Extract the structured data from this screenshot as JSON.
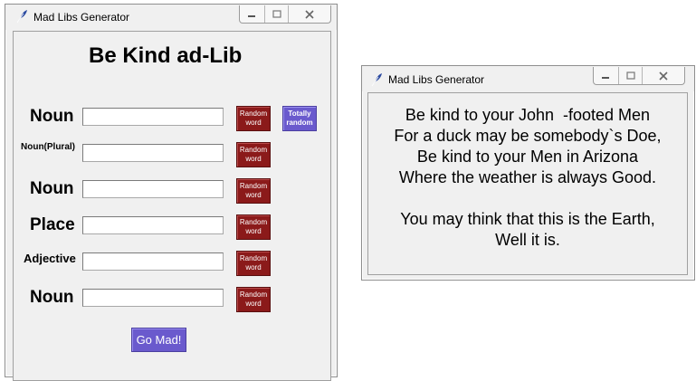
{
  "generator_window": {
    "title": "Mad Libs Generator",
    "heading": "Be Kind ad-Lib",
    "fields": [
      {
        "label": "Noun",
        "value": ""
      },
      {
        "label": "Noun(Plural)",
        "value": ""
      },
      {
        "label": "Noun",
        "value": ""
      },
      {
        "label": "Place",
        "value": ""
      },
      {
        "label": "Adjective",
        "value": ""
      },
      {
        "label": "Noun",
        "value": ""
      }
    ],
    "random_word_label": "Random word",
    "totally_random_label": "Totally random",
    "go_button_label": "Go Mad!",
    "colors": {
      "random_button": "#8b1a1a",
      "accent_button": "#6a5acd"
    }
  },
  "result_window": {
    "title": "Mad Libs Generator",
    "story_lines": [
      "Be kind to your John  -footed Men",
      "For a duck may be somebody`s Doe,",
      "Be kind to your Men in Arizona",
      "Where the weather is always Good.",
      "",
      "You may think that this is the Earth,",
      "Well it is."
    ]
  },
  "icons": {
    "app": "feather-icon",
    "minimize": "minimize-icon",
    "maximize": "maximize-icon",
    "close": "close-icon"
  }
}
